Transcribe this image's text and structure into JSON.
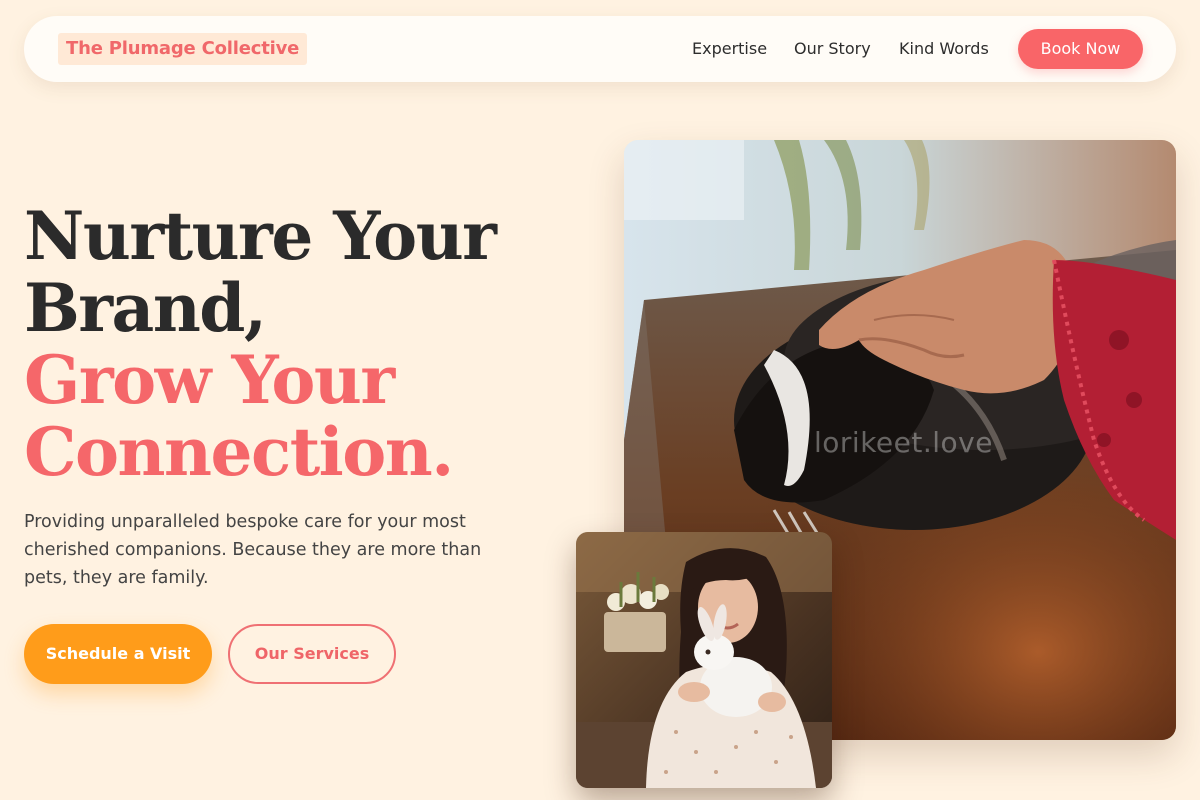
{
  "nav": {
    "logo": "The Plumage Collective",
    "links": [
      "Expertise",
      "Our Story",
      "Kind Words"
    ],
    "cta": "Book Now"
  },
  "hero": {
    "headline_lines": [
      "Nurture Your",
      "Brand,",
      "Grow Your",
      "Connection."
    ],
    "subtext": "Providing unparalleled bespoke care for your most cherished companions. Because they are more than pets, they are family.",
    "primary_button": "Schedule a Visit",
    "secondary_button": "Our Services"
  },
  "images": {
    "main_watermark": "lorikeet.love"
  },
  "colors": {
    "background": "#fff2e1",
    "accent_coral": "#f5676a",
    "accent_orange": "#ff9c1a",
    "text_dark": "#2b2b2b"
  }
}
